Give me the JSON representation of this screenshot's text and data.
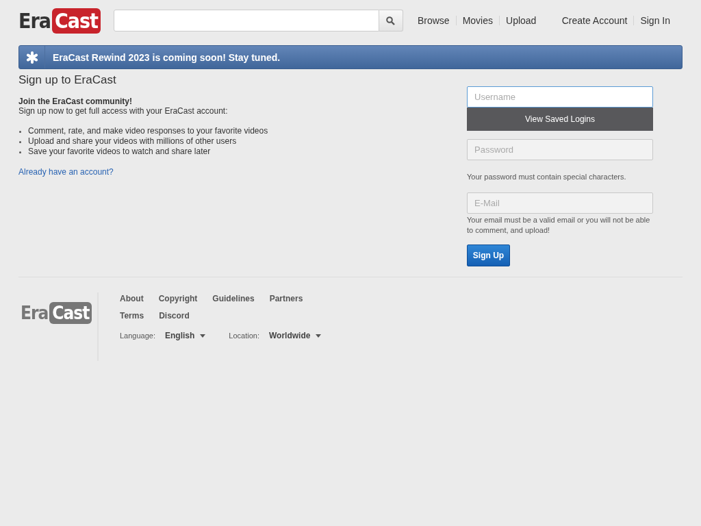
{
  "header": {
    "logo": {
      "part_1": "Era",
      "part_2": "Cast"
    },
    "nav": [
      "Browse",
      "Movies",
      "Upload"
    ],
    "account_links": [
      "Create Account",
      "Sign In"
    ]
  },
  "banner": {
    "text": "EraCast Rewind 2023 is coming soon! Stay tuned."
  },
  "signup": {
    "title": "Sign up to EraCast",
    "intro_heading": "Join the EraCast community!",
    "intro_text": "Sign up now to get full access with your EraCast account:",
    "bullets": [
      "Comment, rate, and make video responses to your favorite videos",
      "Upload and share your videos with millions of other users",
      "Save your favorite videos to watch and share later"
    ],
    "login_link": "Already have an account?"
  },
  "form": {
    "username": {
      "placeholder": "Username",
      "focused": true
    },
    "saved_logins_button": "View Saved Logins",
    "password": {
      "placeholder": "Password",
      "focused": false
    },
    "password_hint": "Your password must contain special characters.",
    "email": {
      "placeholder": "E-Mail",
      "focused": false
    },
    "email_hint": "Your email must be a valid email or you will not be able to comment, and upload!",
    "submit": "Sign Up"
  },
  "footer": {
    "logo": {
      "part_1": "Era",
      "part_2": "Cast"
    },
    "links": [
      [
        "About",
        "Copyright",
        "Guidelines",
        "Partners"
      ],
      [
        "Terms",
        "Discord"
      ]
    ],
    "language": {
      "label": "Language:",
      "value": "English"
    },
    "location": {
      "label": "Location:",
      "value": "Worldwide"
    }
  }
}
